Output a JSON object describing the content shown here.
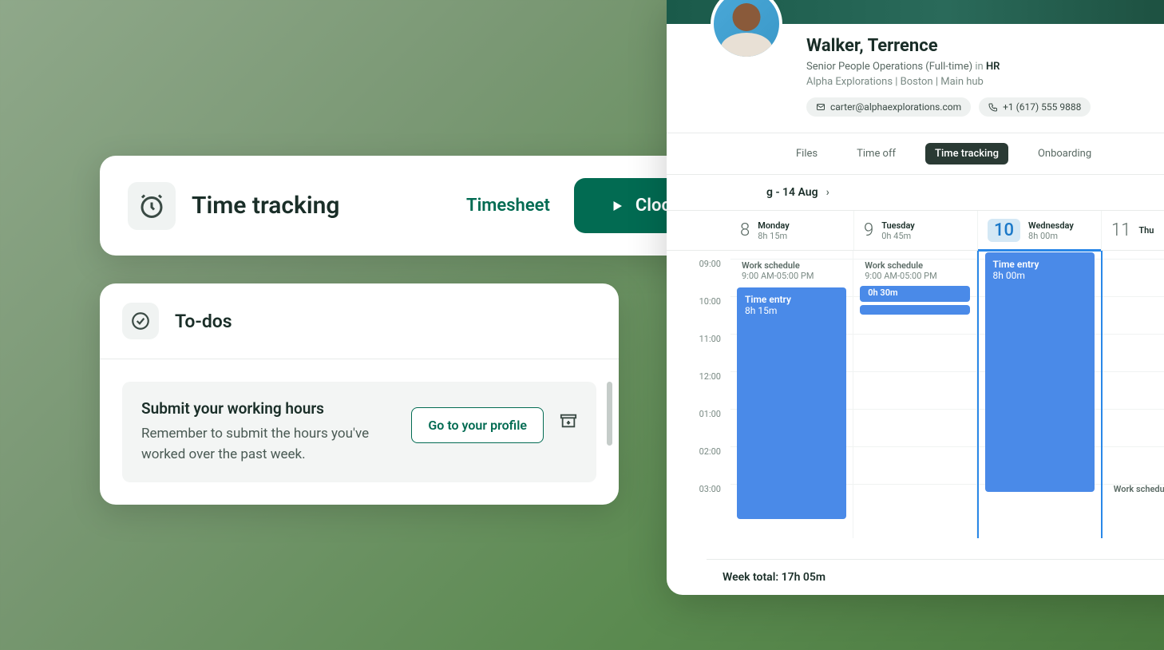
{
  "time_tracking": {
    "title": "Time tracking",
    "timesheet_link": "Timesheet",
    "clock_in_label": "Clock in"
  },
  "todos": {
    "title": "To-dos",
    "item": {
      "title": "Submit your working hours",
      "desc": "Remember to submit the hours you've worked over the past week.",
      "button": "Go to your profile"
    }
  },
  "profile": {
    "name": "Walker, Terrence",
    "role": "Senior People Operations (Full-time)",
    "in_word": "in",
    "dept": "HR",
    "location": "Alpha Explorations | Boston | Main hub",
    "email": "carter@alphaexplorations.com",
    "phone": "+1 (617) 555 9888",
    "tabs": {
      "files": "Files",
      "timeoff": "Time off",
      "timetracking": "Time tracking",
      "onboarding": "Onboarding"
    },
    "date_range": "g - 14 Aug",
    "days": [
      {
        "num": "8",
        "name": "Monday",
        "hours": "8h 15m"
      },
      {
        "num": "9",
        "name": "Tuesday",
        "hours": "0h 45m"
      },
      {
        "num": "10",
        "name": "Wednesday",
        "hours": "8h 00m"
      },
      {
        "num": "11",
        "name": "Thu"
      }
    ],
    "time_labels": [
      "09:00",
      "10:00",
      "11:00",
      "12:00",
      "01:00",
      "02:00",
      "03:00"
    ],
    "schedule": {
      "label": "Work schedule",
      "range": "9:00 AM-05:00 PM"
    },
    "entries": {
      "mon": {
        "label": "Time entry",
        "dur": "8h 15m"
      },
      "tue_small": "0h 30m",
      "wed": {
        "label": "Time entry",
        "dur": "8h 00m"
      }
    },
    "week_total": "Week total: 17h 05m"
  }
}
